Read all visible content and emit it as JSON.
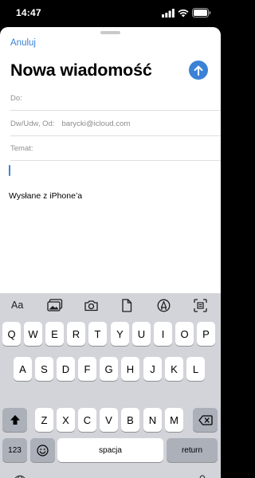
{
  "status": {
    "time": "14:47"
  },
  "compose": {
    "cancel_label": "Anuluj",
    "title": "Nowa wiadomość",
    "to_label": "Do:",
    "cc_label": "Dw/Udw, Od:",
    "from_value": "barycki@icloud.com",
    "subject_label": "Temat:",
    "signature": "Wysłane z iPhone’a"
  },
  "toolbar": {
    "text_format_label": "Aa"
  },
  "keyboard": {
    "row1": [
      "Q",
      "W",
      "E",
      "R",
      "T",
      "Y",
      "U",
      "I",
      "O",
      "P"
    ],
    "row2": [
      "A",
      "S",
      "D",
      "F",
      "G",
      "H",
      "J",
      "K",
      "L"
    ],
    "row3": [
      "Z",
      "X",
      "C",
      "V",
      "B",
      "N",
      "M"
    ],
    "numbers_label": "123",
    "space_label": "spacja",
    "return_label": "return"
  },
  "colors": {
    "accent": "#3b82d6",
    "keyboard_bg": "#d2d4d9"
  }
}
